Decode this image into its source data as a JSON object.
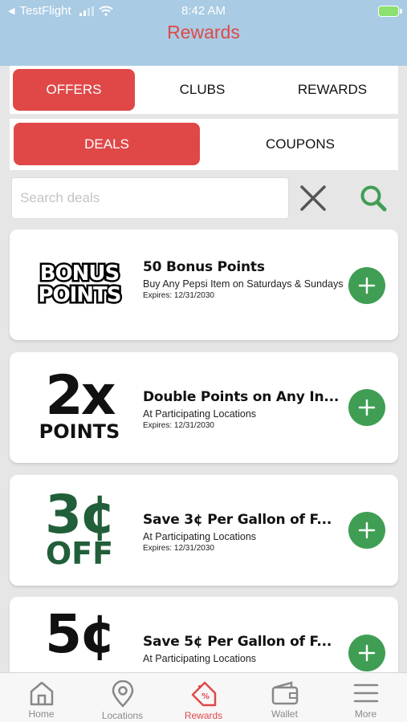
{
  "status_bar": {
    "carrier": "TestFlight",
    "time": "8:42 AM"
  },
  "header": {
    "title": "Rewards"
  },
  "top_tabs": [
    {
      "label": "OFFERS",
      "active": true
    },
    {
      "label": "CLUBS",
      "active": false
    },
    {
      "label": "REWARDS",
      "active": false
    }
  ],
  "segments": [
    {
      "label": "DEALS",
      "active": true
    },
    {
      "label": "COUPONS",
      "active": false
    }
  ],
  "search": {
    "placeholder": "Search deals",
    "value": ""
  },
  "deals": [
    {
      "logo_line1": "BONUS",
      "logo_line2": "POINTS",
      "title": "50 Bonus Points",
      "description": "Buy Any Pepsi Item on Saturdays & Sundays",
      "expires": "Expires: 12/31/2030"
    },
    {
      "logo_big": "2x",
      "logo_small": "POINTS",
      "title": "Double Points on Any In...",
      "description": "At Participating Locations",
      "expires": "Expires: 12/31/2030"
    },
    {
      "logo_big": "3¢",
      "logo_small": "OFF",
      "title": "Save 3¢ Per Gallon of F...",
      "description": "At Participating Locations",
      "expires": "Expires: 12/31/2030"
    },
    {
      "logo_big": "5¢",
      "title": "Save 5¢ Per Gallon of F...",
      "description": "At Participating Locations"
    }
  ],
  "bottom_nav": [
    {
      "label": "Home",
      "icon": "home-icon"
    },
    {
      "label": "Locations",
      "icon": "location-pin-icon"
    },
    {
      "label": "Rewards",
      "icon": "rewards-tag-icon",
      "active": true
    },
    {
      "label": "Wallet",
      "icon": "wallet-icon"
    },
    {
      "label": "More",
      "icon": "menu-icon"
    }
  ],
  "colors": {
    "accent": "#e04848",
    "header_bg": "#a9cbe4",
    "add_green": "#3f9e53",
    "off_green": "#215f3a"
  }
}
